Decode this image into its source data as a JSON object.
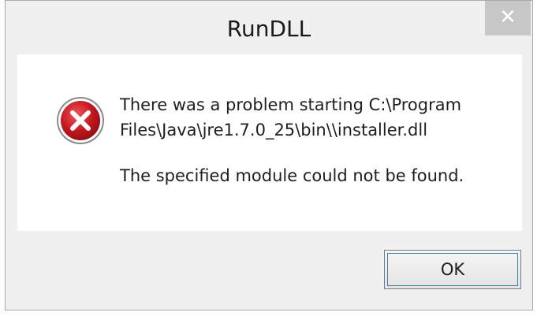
{
  "window": {
    "title": "RunDLL",
    "close_glyph": "✕"
  },
  "dialog": {
    "icon": "error-icon",
    "message_line_1": "There was a problem starting C:\\Program",
    "message_line_2": "Files\\Java\\jre1.7.0_25\\bin\\\\installer.dll",
    "detail": "The specified module could not be found."
  },
  "buttons": {
    "ok_label": "OK"
  },
  "colors": {
    "error_red": "#c4161c",
    "close_button": "#c7c7c7",
    "focus_ring": "#3c7fb1"
  }
}
